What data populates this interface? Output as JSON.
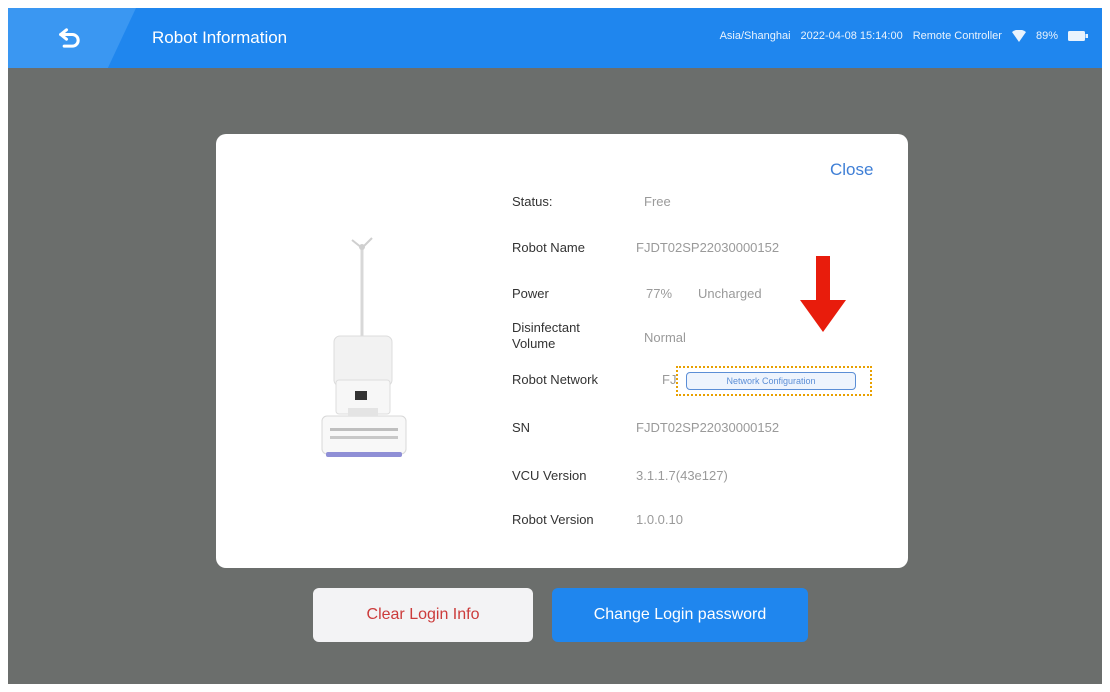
{
  "header": {
    "title": "Robot Information",
    "timezone": "Asia/Shanghai",
    "datetime": "2022-04-08 15:14:00",
    "controller": "Remote Controller",
    "battery": "89%"
  },
  "dialog": {
    "close_label": "Close",
    "fields": {
      "status_label": "Status:",
      "status_value": "Free",
      "robot_name_label": "Robot Name",
      "robot_name_value": "FJDT02SP22030000152",
      "power_label": "Power",
      "power_value": "77%",
      "power_state": "Uncharged",
      "disinfectant_label_1": "Disinfectant",
      "disinfectant_label_2": "Volume",
      "disinfectant_value": "Normal",
      "network_label": "Robot Network",
      "network_value": "FJ",
      "network_button": "Network Configuration",
      "sn_label": "SN",
      "sn_value": "FJDT02SP22030000152",
      "vcu_label": "VCU Version",
      "vcu_value": "3.1.1.7(43e127)",
      "robot_version_label": "Robot Version",
      "robot_version_value": "1.0.0.10"
    }
  },
  "actions": {
    "clear_label": "Clear Login Info",
    "change_label": "Change Login password"
  },
  "colors": {
    "accent": "#1f86ee",
    "annotation_arrow": "#e81c0c",
    "annotation_box": "#e8a000"
  }
}
